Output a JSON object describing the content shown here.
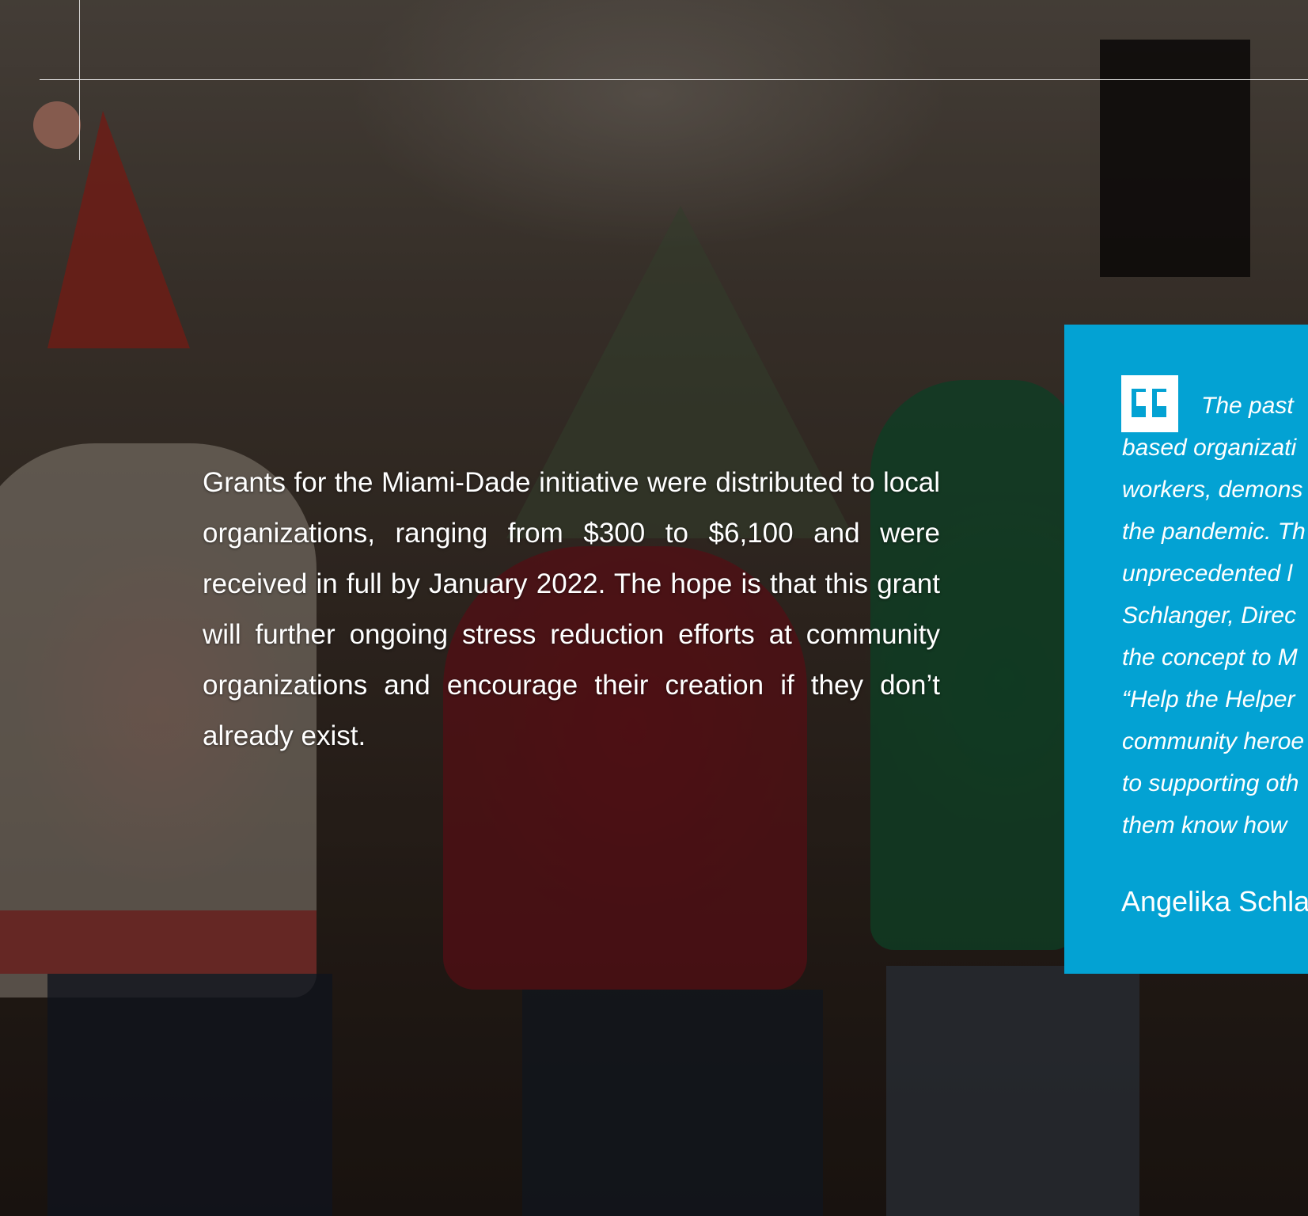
{
  "body": {
    "paragraph": "Grants for the Miami-Dade initiative were distributed to local organizations, ranging from $300 to $6,100 and were received in full by January 2022. The hope is that this grant will further ongoing stress reduction efforts at community organizations and encourage their creation if they don’t already exist."
  },
  "quote": {
    "lines": [
      "The past",
      "based organizati",
      "workers, demons",
      "the pandemic. Th",
      "unprecedented l",
      "Schlanger, Direc",
      "the concept to M",
      "“Help the Helper",
      "community heroe",
      "to supporting oth",
      "them know how"
    ],
    "author": "Angelika Schla"
  },
  "colors": {
    "quote_box": "#03a2d3",
    "text": "#ffffff"
  },
  "icons": {
    "quote": "quote-mark-icon"
  }
}
